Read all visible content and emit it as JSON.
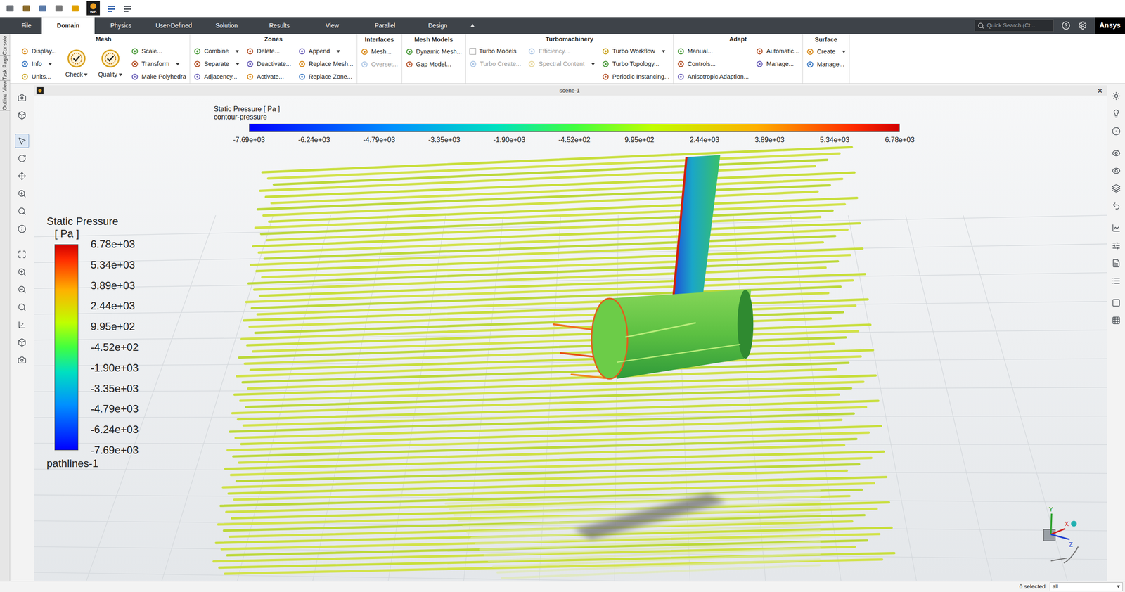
{
  "quick_access": {
    "wb_label": "WB"
  },
  "tabs": [
    {
      "label": "File",
      "selected": false
    },
    {
      "label": "Domain",
      "selected": true
    },
    {
      "label": "Physics",
      "selected": false
    },
    {
      "label": "User-Defined",
      "selected": false
    },
    {
      "label": "Solution",
      "selected": false
    },
    {
      "label": "Results",
      "selected": false
    },
    {
      "label": "View",
      "selected": false
    },
    {
      "label": "Parallel",
      "selected": false
    },
    {
      "label": "Design",
      "selected": false
    }
  ],
  "search": {
    "placeholder": "Quick Search (Ct..."
  },
  "brand": "Ansys",
  "ribbon": {
    "groups": [
      {
        "title": "Mesh",
        "columns": [
          [
            {
              "label": "Display...",
              "kind": "button",
              "disabled": false,
              "dropdown": false
            },
            {
              "label": "Info",
              "kind": "button",
              "disabled": false,
              "dropdown": true
            },
            {
              "label": "Units...",
              "kind": "button",
              "disabled": false,
              "dropdown": false
            }
          ],
          [
            {
              "label": "Check",
              "kind": "large",
              "disabled": false,
              "dropdown": true
            }
          ],
          [
            {
              "label": "Quality",
              "kind": "large",
              "disabled": false,
              "dropdown": true
            }
          ],
          [
            {
              "label": "Scale...",
              "kind": "button",
              "disabled": false,
              "dropdown": false
            },
            {
              "label": "Transform",
              "kind": "button",
              "disabled": false,
              "dropdown": true
            },
            {
              "label": "Make Polyhedra",
              "kind": "button",
              "disabled": false,
              "dropdown": false
            }
          ]
        ]
      },
      {
        "title": "Zones",
        "columns": [
          [
            {
              "label": "Combine",
              "kind": "button",
              "disabled": false,
              "dropdown": true
            },
            {
              "label": "Separate",
              "kind": "button",
              "disabled": false,
              "dropdown": true
            },
            {
              "label": "Adjacency...",
              "kind": "button",
              "disabled": false,
              "dropdown": false
            }
          ],
          [
            {
              "label": "Delete...",
              "kind": "button",
              "disabled": false,
              "dropdown": false
            },
            {
              "label": "Deactivate...",
              "kind": "button",
              "disabled": false,
              "dropdown": false
            },
            {
              "label": "Activate...",
              "kind": "button",
              "disabled": false,
              "dropdown": false
            }
          ],
          [
            {
              "label": "Append",
              "kind": "button",
              "disabled": false,
              "dropdown": true
            },
            {
              "label": "Replace Mesh...",
              "kind": "button",
              "disabled": false,
              "dropdown": false
            },
            {
              "label": "Replace Zone...",
              "kind": "button",
              "disabled": false,
              "dropdown": false
            }
          ]
        ]
      },
      {
        "title": "Interfaces",
        "columns": [
          [
            {
              "label": "Mesh...",
              "kind": "button",
              "disabled": false,
              "dropdown": false
            },
            {
              "label": "Overset...",
              "kind": "button",
              "disabled": true,
              "dropdown": false
            }
          ]
        ]
      },
      {
        "title": "Mesh Models",
        "columns": [
          [
            {
              "label": "Dynamic Mesh...",
              "kind": "button",
              "disabled": false,
              "dropdown": false
            },
            {
              "label": "Gap Model...",
              "kind": "button",
              "disabled": false,
              "dropdown": false
            }
          ]
        ]
      },
      {
        "title": "Turbomachinery",
        "columns": [
          [
            {
              "label": "Turbo Models",
              "kind": "checkbox",
              "checked": false,
              "disabled": false,
              "dropdown": false
            },
            {
              "label": "Turbo Create...",
              "kind": "button",
              "disabled": true,
              "dropdown": false
            }
          ],
          [
            {
              "label": "Efficiency...",
              "kind": "button",
              "disabled": true,
              "dropdown": false
            },
            {
              "label": "Spectral Content",
              "kind": "button",
              "disabled": true,
              "dropdown": true
            }
          ],
          [
            {
              "label": "Turbo Workflow",
              "kind": "button",
              "disabled": false,
              "dropdown": true
            },
            {
              "label": "Turbo Topology...",
              "kind": "button",
              "disabled": false,
              "dropdown": false
            },
            {
              "label": "Periodic Instancing...",
              "kind": "button",
              "disabled": false,
              "dropdown": false
            }
          ]
        ]
      },
      {
        "title": "Adapt",
        "columns": [
          [
            {
              "label": "Manual...",
              "kind": "button",
              "disabled": false,
              "dropdown": false
            },
            {
              "label": "Controls...",
              "kind": "button",
              "disabled": false,
              "dropdown": false
            },
            {
              "label": "Anisotropic Adaption...",
              "kind": "button",
              "disabled": false,
              "dropdown": false
            }
          ],
          [
            {
              "label": "Automatic...",
              "kind": "button",
              "disabled": false,
              "dropdown": false
            },
            {
              "label": "Manage...",
              "kind": "button",
              "disabled": false,
              "dropdown": false
            }
          ]
        ]
      },
      {
        "title": "Surface",
        "columns": [
          [
            {
              "label": "Create",
              "kind": "button",
              "disabled": false,
              "dropdown": true
            },
            {
              "label": "Manage...",
              "kind": "button",
              "disabled": false,
              "dropdown": false
            }
          ]
        ]
      }
    ]
  },
  "side_tabs": [
    "Outline View",
    "Task Page",
    "Console"
  ],
  "scene": {
    "title": "scene-1",
    "close": "×"
  },
  "top_colorbar": {
    "title": "Static Pressure [ Pa ]",
    "subtitle": "contour-pressure",
    "ticks": [
      "-7.69e+03",
      "-6.24e+03",
      "-4.79e+03",
      "-3.35e+03",
      "-1.90e+03",
      "-4.52e+02",
      "9.95e+02",
      "2.44e+03",
      "3.89e+03",
      "5.34e+03",
      "6.78e+03"
    ]
  },
  "legend": {
    "title": "Static Pressure",
    "unit": "[ Pa ]",
    "ticks": [
      "6.78e+03",
      "5.34e+03",
      "3.89e+03",
      "2.44e+03",
      "9.95e+02",
      "-4.52e+02",
      "-1.90e+03",
      "-3.35e+03",
      "-4.79e+03",
      "-6.24e+03",
      "-7.69e+03"
    ],
    "caption": "pathlines-1"
  },
  "triad": {
    "axes": [
      "X",
      "Y",
      "Z"
    ]
  },
  "status_bar": {
    "selected": "0 selected",
    "filter": "all"
  }
}
